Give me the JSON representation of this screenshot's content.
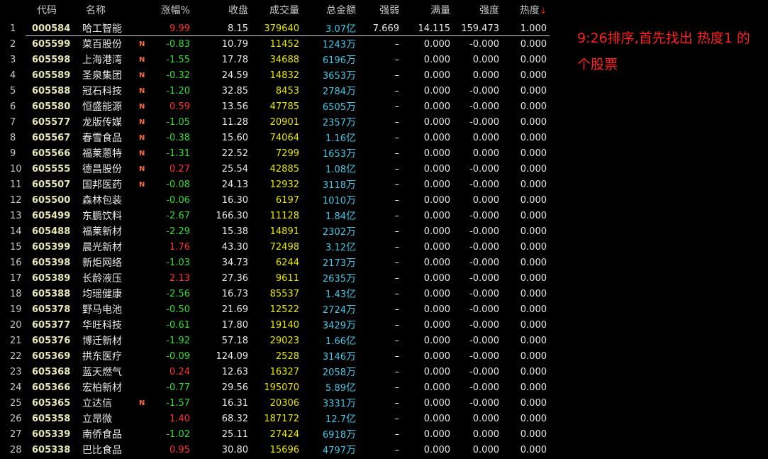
{
  "headers": {
    "code": "代码",
    "name": "名称",
    "change": "涨幅%",
    "close": "收盘",
    "volume": "成交量",
    "amount": "总金额",
    "strength": "强弱",
    "full": "满量",
    "force": "强度",
    "heat": "热度",
    "sort_arrow": "↓"
  },
  "rows": [
    {
      "n": "1",
      "code": "000584",
      "name": "哈工智能",
      "flag": "",
      "chg": "9.99",
      "dir": "up",
      "close": "8.15",
      "vol": "379640",
      "amt": "3.07",
      "unit": "亿",
      "str": "7.669",
      "full": "14.115",
      "force": "159.473",
      "heat": "1.000"
    },
    {
      "n": "2",
      "code": "605599",
      "name": "菜百股份",
      "flag": "N",
      "chg": "-0.83",
      "dir": "down",
      "close": "10.79",
      "vol": "11452",
      "amt": "1243",
      "unit": "万",
      "str": "–",
      "full": "0.000",
      "force": "-0.000",
      "heat": "0.000"
    },
    {
      "n": "3",
      "code": "605598",
      "name": "上海港湾",
      "flag": "N",
      "chg": "-1.55",
      "dir": "down",
      "close": "17.78",
      "vol": "34688",
      "amt": "6196",
      "unit": "万",
      "str": "–",
      "full": "0.000",
      "force": "0.000",
      "heat": "0.000"
    },
    {
      "n": "4",
      "code": "605589",
      "name": "圣泉集团",
      "flag": "N",
      "chg": "-0.32",
      "dir": "down",
      "close": "24.59",
      "vol": "14832",
      "amt": "3653",
      "unit": "万",
      "str": "–",
      "full": "0.000",
      "force": "0.000",
      "heat": "0.000"
    },
    {
      "n": "5",
      "code": "605588",
      "name": "冠石科技",
      "flag": "N",
      "chg": "-1.20",
      "dir": "down",
      "close": "32.85",
      "vol": "8453",
      "amt": "2784",
      "unit": "万",
      "str": "–",
      "full": "0.000",
      "force": "-0.000",
      "heat": "0.000"
    },
    {
      "n": "6",
      "code": "605580",
      "name": "恒盛能源",
      "flag": "N",
      "chg": "0.59",
      "dir": "up",
      "close": "13.56",
      "vol": "47785",
      "amt": "6505",
      "unit": "万",
      "str": "–",
      "full": "0.000",
      "force": "-0.000",
      "heat": "0.000"
    },
    {
      "n": "7",
      "code": "605577",
      "name": "龙版传媒",
      "flag": "N",
      "chg": "-1.05",
      "dir": "down",
      "close": "11.28",
      "vol": "20901",
      "amt": "2357",
      "unit": "万",
      "str": "–",
      "full": "0.000",
      "force": "-0.000",
      "heat": "0.000"
    },
    {
      "n": "8",
      "code": "605567",
      "name": "春雪食品",
      "flag": "N",
      "chg": "-0.38",
      "dir": "down",
      "close": "15.60",
      "vol": "74064",
      "amt": "1.16",
      "unit": "亿",
      "str": "–",
      "full": "0.000",
      "force": "0.000",
      "heat": "0.000"
    },
    {
      "n": "9",
      "code": "605566",
      "name": "福莱蒽特",
      "flag": "N",
      "chg": "-1.31",
      "dir": "down",
      "close": "22.52",
      "vol": "7299",
      "amt": "1653",
      "unit": "万",
      "str": "–",
      "full": "0.000",
      "force": "0.000",
      "heat": "0.000"
    },
    {
      "n": "10",
      "code": "605555",
      "name": "德昌股份",
      "flag": "N",
      "chg": "0.27",
      "dir": "up",
      "close": "25.54",
      "vol": "42885",
      "amt": "1.08",
      "unit": "亿",
      "str": "–",
      "full": "0.000",
      "force": "-0.000",
      "heat": "0.000"
    },
    {
      "n": "11",
      "code": "605507",
      "name": "国邦医药",
      "flag": "N",
      "chg": "-0.08",
      "dir": "down",
      "close": "24.13",
      "vol": "12932",
      "amt": "3118",
      "unit": "万",
      "str": "–",
      "full": "0.000",
      "force": "-0.000",
      "heat": "0.000"
    },
    {
      "n": "12",
      "code": "605500",
      "name": "森林包装",
      "flag": "",
      "chg": "-0.06",
      "dir": "down",
      "close": "16.30",
      "vol": "6197",
      "amt": "1010",
      "unit": "万",
      "str": "–",
      "full": "0.000",
      "force": "0.000",
      "heat": "0.000"
    },
    {
      "n": "13",
      "code": "605499",
      "name": "东鹏饮料",
      "flag": "",
      "chg": "-2.67",
      "dir": "down",
      "close": "166.30",
      "vol": "11128",
      "amt": "1.84",
      "unit": "亿",
      "str": "–",
      "full": "0.000",
      "force": "-0.000",
      "heat": "0.000"
    },
    {
      "n": "14",
      "code": "605488",
      "name": "福莱新材",
      "flag": "",
      "chg": "-2.29",
      "dir": "down",
      "close": "15.38",
      "vol": "14891",
      "amt": "2302",
      "unit": "万",
      "str": "–",
      "full": "0.000",
      "force": "-0.000",
      "heat": "0.000"
    },
    {
      "n": "15",
      "code": "605399",
      "name": "晨光新材",
      "flag": "",
      "chg": "1.76",
      "dir": "up",
      "close": "43.30",
      "vol": "72498",
      "amt": "3.12",
      "unit": "亿",
      "str": "–",
      "full": "0.000",
      "force": "-0.000",
      "heat": "0.000"
    },
    {
      "n": "16",
      "code": "605398",
      "name": "新炬网络",
      "flag": "",
      "chg": "-1.03",
      "dir": "down",
      "close": "34.73",
      "vol": "6244",
      "amt": "2173",
      "unit": "万",
      "str": "–",
      "full": "0.000",
      "force": "-0.000",
      "heat": "0.000"
    },
    {
      "n": "17",
      "code": "605389",
      "name": "长龄液压",
      "flag": "",
      "chg": "2.13",
      "dir": "up",
      "close": "27.36",
      "vol": "9611",
      "amt": "2635",
      "unit": "万",
      "str": "–",
      "full": "0.000",
      "force": "-0.000",
      "heat": "0.000"
    },
    {
      "n": "18",
      "code": "605388",
      "name": "均瑶健康",
      "flag": "",
      "chg": "-2.56",
      "dir": "down",
      "close": "16.73",
      "vol": "85537",
      "amt": "1.43",
      "unit": "亿",
      "str": "–",
      "full": "0.000",
      "force": "-0.000",
      "heat": "0.000"
    },
    {
      "n": "19",
      "code": "605378",
      "name": "野马电池",
      "flag": "",
      "chg": "-0.50",
      "dir": "down",
      "close": "21.69",
      "vol": "12522",
      "amt": "2724",
      "unit": "万",
      "str": "–",
      "full": "0.000",
      "force": "-0.000",
      "heat": "0.000"
    },
    {
      "n": "20",
      "code": "605377",
      "name": "华旺科技",
      "flag": "",
      "chg": "-0.61",
      "dir": "down",
      "close": "17.80",
      "vol": "19140",
      "amt": "3429",
      "unit": "万",
      "str": "–",
      "full": "0.000",
      "force": "-0.000",
      "heat": "0.000"
    },
    {
      "n": "21",
      "code": "605376",
      "name": "博迁新材",
      "flag": "",
      "chg": "-1.92",
      "dir": "down",
      "close": "57.18",
      "vol": "29023",
      "amt": "1.66",
      "unit": "亿",
      "str": "–",
      "full": "0.000",
      "force": "-0.000",
      "heat": "0.000"
    },
    {
      "n": "22",
      "code": "605369",
      "name": "拱东医疗",
      "flag": "",
      "chg": "-0.09",
      "dir": "down",
      "close": "124.09",
      "vol": "2528",
      "amt": "3146",
      "unit": "万",
      "str": "–",
      "full": "0.000",
      "force": "-0.000",
      "heat": "0.000"
    },
    {
      "n": "23",
      "code": "605368",
      "name": "蓝天燃气",
      "flag": "",
      "chg": "0.24",
      "dir": "up",
      "close": "12.63",
      "vol": "16327",
      "amt": "2058",
      "unit": "万",
      "str": "–",
      "full": "0.000",
      "force": "-0.000",
      "heat": "0.000"
    },
    {
      "n": "24",
      "code": "605366",
      "name": "宏柏新材",
      "flag": "",
      "chg": "-0.77",
      "dir": "down",
      "close": "29.56",
      "vol": "195070",
      "amt": "5.89",
      "unit": "亿",
      "str": "–",
      "full": "0.000",
      "force": "-0.000",
      "heat": "0.000"
    },
    {
      "n": "25",
      "code": "605365",
      "name": "立达信",
      "flag": "N",
      "chg": "-1.57",
      "dir": "down",
      "close": "16.31",
      "vol": "20306",
      "amt": "3331",
      "unit": "万",
      "str": "–",
      "full": "0.000",
      "force": "-0.000",
      "heat": "0.000"
    },
    {
      "n": "26",
      "code": "605358",
      "name": "立昂微",
      "flag": "",
      "chg": "1.40",
      "dir": "up",
      "close": "68.32",
      "vol": "187172",
      "amt": "12.7",
      "unit": "亿",
      "str": "–",
      "full": "0.000",
      "force": "0.000",
      "heat": "0.000"
    },
    {
      "n": "27",
      "code": "605339",
      "name": "南侨食品",
      "flag": "",
      "chg": "-1.02",
      "dir": "down",
      "close": "25.11",
      "vol": "27424",
      "amt": "6918",
      "unit": "万",
      "str": "–",
      "full": "0.000",
      "force": "0.000",
      "heat": "0.000"
    },
    {
      "n": "28",
      "code": "605338",
      "name": "巴比食品",
      "flag": "",
      "chg": "0.95",
      "dir": "up",
      "close": "30.80",
      "vol": "15696",
      "amt": "4797",
      "unit": "万",
      "str": "–",
      "full": "0.000",
      "force": "0.000",
      "heat": "0.000"
    }
  ],
  "note": "9:26排序,首先找出  热度1  的个股票"
}
